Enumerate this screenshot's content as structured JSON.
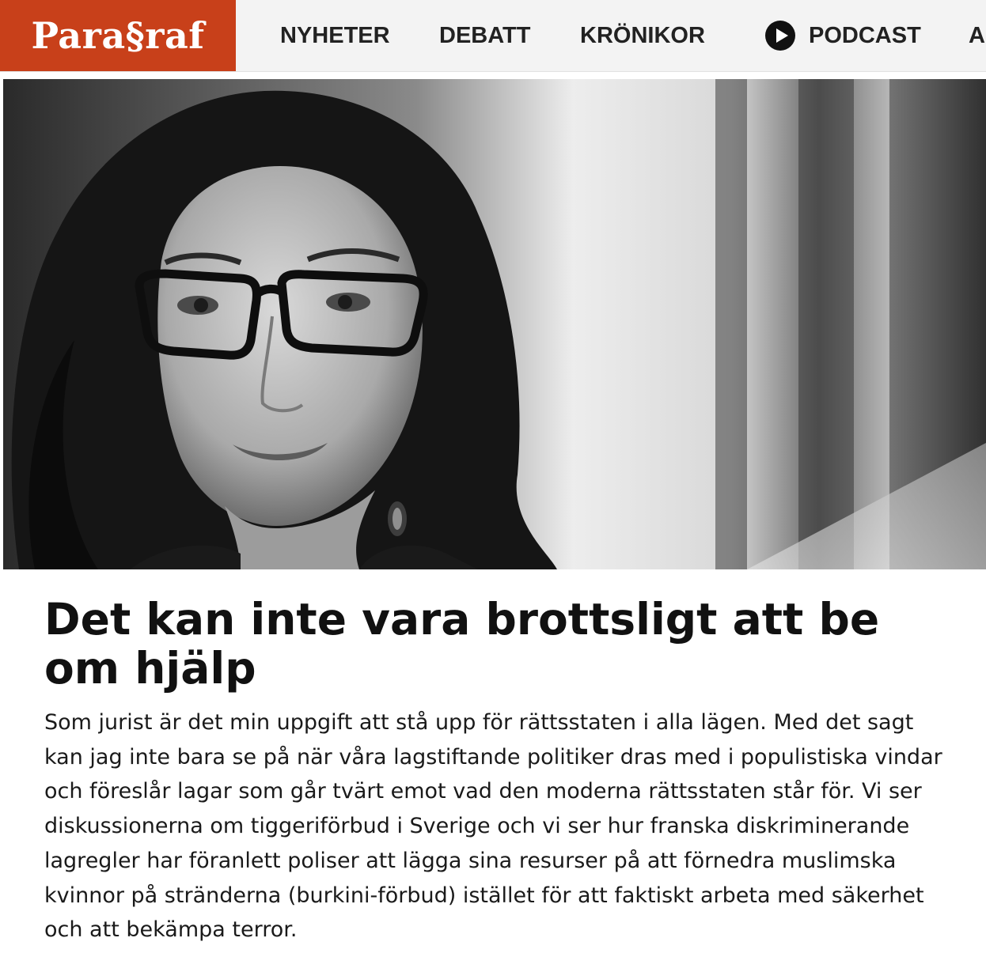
{
  "site": {
    "logo_text": "Para§raf",
    "brand_color": "#c8401a"
  },
  "nav": {
    "items": [
      {
        "label": "NYHETER"
      },
      {
        "label": "DEBATT"
      },
      {
        "label": "KRÖNIKOR"
      },
      {
        "label": "PODCAST",
        "icon": "play-icon"
      },
      {
        "label": "A"
      }
    ]
  },
  "article": {
    "image_icon": "author-portrait-photo",
    "title": "Det kan inte vara brottsligt att be om hjälp",
    "lead": "Som jurist är det min uppgift att stå upp för rättsstaten i alla lägen. Med det sagt kan jag inte bara se på när våra lagstiftande politiker dras med i populistiska vindar och föreslår lagar som går tvärt emot vad den moderna rättsstaten står för. Vi ser diskussionerna om tiggeriförbud i Sverige och vi ser hur franska diskriminerande lagregler har föranlett poliser att lägga sina resurser på att förnedra muslimska kvinnor på stränderna (burkini-förbud) istället för att faktiskt arbeta med säkerhet och att bekämpa terror."
  }
}
